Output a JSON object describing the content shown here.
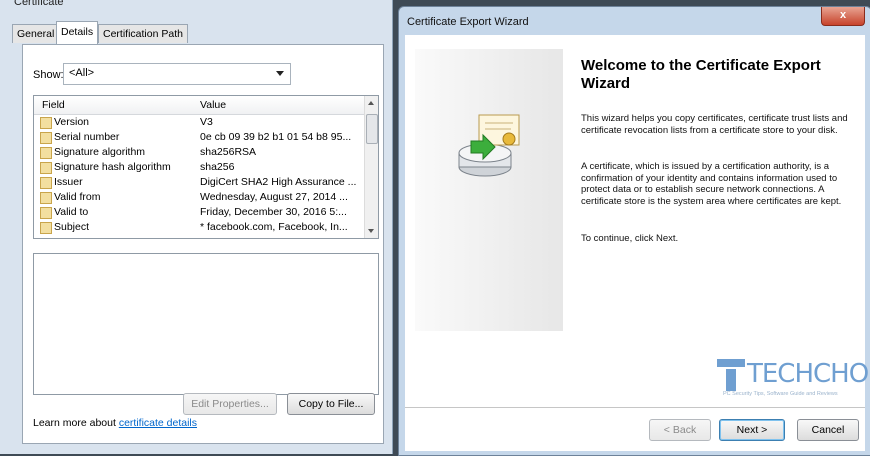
{
  "cert": {
    "window_title": "Certificate",
    "tabs": [
      "General",
      "Details",
      "Certification Path"
    ],
    "show_label": "Show:",
    "show_value": "<All>",
    "headers": {
      "field": "Field",
      "value": "Value"
    },
    "rows": [
      {
        "field": "Version",
        "value": "V3"
      },
      {
        "field": "Serial number",
        "value": "0e cb 09 39 b2 b1 01 54 b8 95..."
      },
      {
        "field": "Signature algorithm",
        "value": "sha256RSA"
      },
      {
        "field": "Signature hash algorithm",
        "value": "sha256"
      },
      {
        "field": "Issuer",
        "value": "DigiCert SHA2 High Assurance ..."
      },
      {
        "field": "Valid from",
        "value": "Wednesday, August 27, 2014 ..."
      },
      {
        "field": "Valid to",
        "value": "Friday, December 30, 2016 5:..."
      },
      {
        "field": "Subject",
        "value": "* facebook.com, Facebook, In..."
      }
    ],
    "edit_properties": "Edit Properties...",
    "copy_to_file": "Copy to File...",
    "learn_prefix": "Learn more about ",
    "learn_link": "certificate details"
  },
  "wizard": {
    "title": "Certificate Export Wizard",
    "close": "x",
    "heading": "Welcome to the Certificate Export Wizard",
    "p1": "This wizard helps you copy certificates, certificate trust lists and certificate revocation lists from a certificate store to your disk.",
    "p2": "A certificate, which is issued by a certification authority, is a confirmation of your identity and contains information used to protect data or to establish secure network connections. A certificate store is the system area where certificates are kept.",
    "p3": "To continue, click Next.",
    "back": "< Back",
    "next": "Next >",
    "cancel": "Cancel"
  },
  "watermark": {
    "text": "TECHCHORE",
    "tagline": "PC Security Tips, Software Guide and Reviews"
  }
}
